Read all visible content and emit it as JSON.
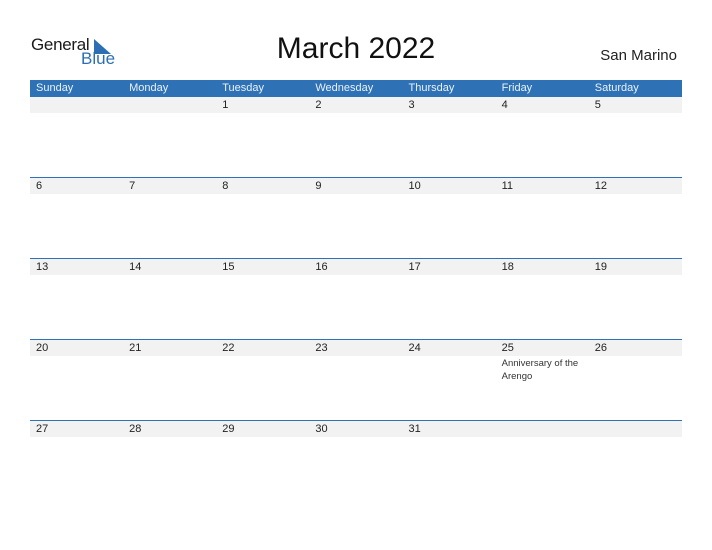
{
  "logo": {
    "general": "General",
    "blue": "Blue"
  },
  "title": "March 2022",
  "country": "San Marino",
  "weekdays": [
    "Sunday",
    "Monday",
    "Tuesday",
    "Wednesday",
    "Thursday",
    "Friday",
    "Saturday"
  ],
  "weeks": [
    {
      "days": [
        "",
        "",
        "1",
        "2",
        "3",
        "4",
        "5"
      ],
      "events": [
        "",
        "",
        "",
        "",
        "",
        "",
        ""
      ]
    },
    {
      "days": [
        "6",
        "7",
        "8",
        "9",
        "10",
        "11",
        "12"
      ],
      "events": [
        "",
        "",
        "",
        "",
        "",
        "",
        ""
      ]
    },
    {
      "days": [
        "13",
        "14",
        "15",
        "16",
        "17",
        "18",
        "19"
      ],
      "events": [
        "",
        "",
        "",
        "",
        "",
        "",
        ""
      ]
    },
    {
      "days": [
        "20",
        "21",
        "22",
        "23",
        "24",
        "25",
        "26"
      ],
      "events": [
        "",
        "",
        "",
        "",
        "",
        "Anniversary of the Arengo",
        ""
      ]
    },
    {
      "days": [
        "27",
        "28",
        "29",
        "30",
        "31",
        "",
        ""
      ],
      "events": [
        "",
        "",
        "",
        "",
        "",
        "",
        ""
      ]
    }
  ],
  "colors": {
    "accent": "#2e72b5",
    "day_bar": "#f2f2f2"
  }
}
